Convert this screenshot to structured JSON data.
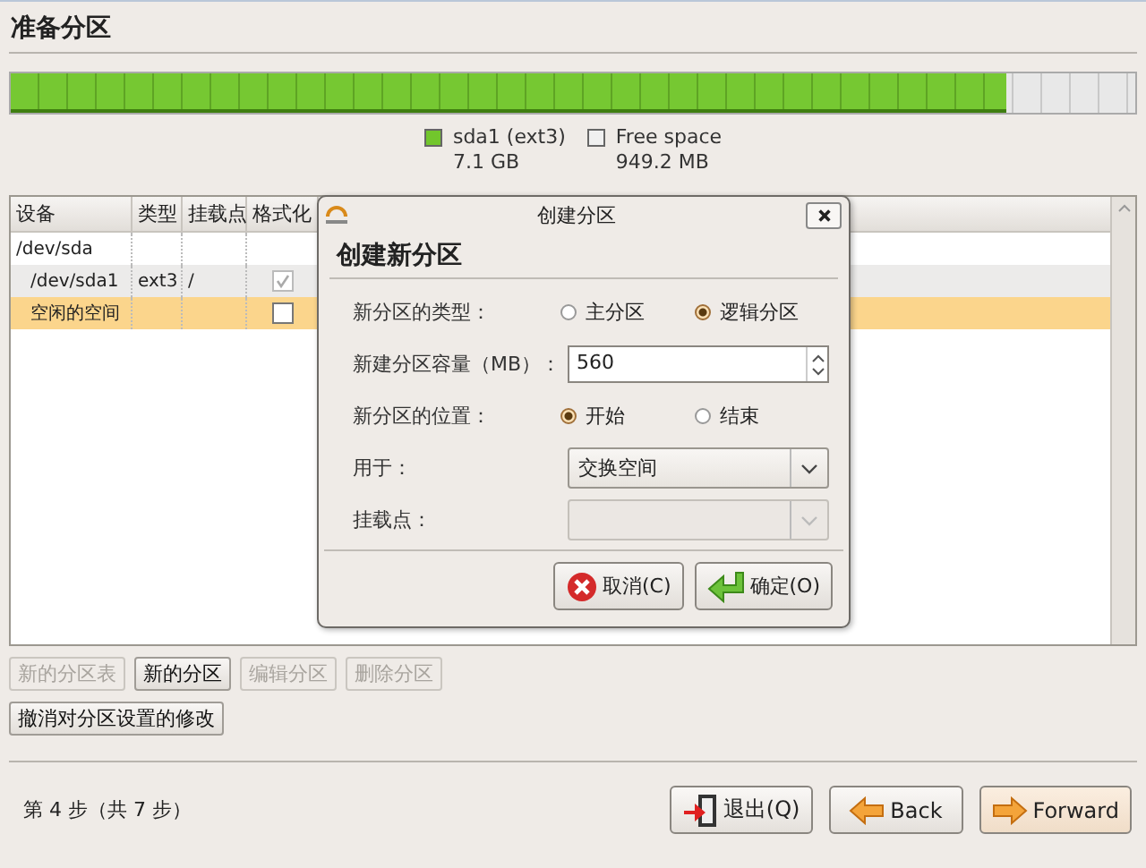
{
  "title": "准备分区",
  "disk_bar": {
    "level": 0.885
  },
  "legend": [
    {
      "name": "sda1 (ext3)",
      "size": "7.1 GB",
      "color": "#72c62c"
    },
    {
      "name": "Free space",
      "size": "949.2 MB",
      "color": "#f0f0f0"
    }
  ],
  "table": {
    "columns": [
      "设备",
      "类型",
      "挂载点",
      "格式化"
    ],
    "rows": [
      {
        "device": "/dev/sda",
        "selected": false,
        "children": [
          {
            "device": "/dev/sda1",
            "type": "ext3",
            "mount": "/",
            "format": {
              "checked": true,
              "disabled": true
            },
            "selected": false
          },
          {
            "device": "空闲的空间",
            "format": {
              "checked": false,
              "disabled": false
            },
            "selected": true
          }
        ]
      }
    ]
  },
  "dialog": {
    "title": "创建分区",
    "heading": "创建新分区",
    "fields": [
      {
        "kind": "radio",
        "label": "新分区的类型：",
        "options": [
          {
            "label": "主分区",
            "selected": false
          },
          {
            "label": "逻辑分区",
            "selected": true
          }
        ]
      },
      {
        "kind": "spin",
        "label": "新建分区容量（MB）：",
        "value": "560"
      },
      {
        "kind": "radio",
        "label": "新分区的位置：",
        "options": [
          {
            "label": "开始",
            "selected": true
          },
          {
            "label": "结束",
            "selected": false
          }
        ]
      },
      {
        "kind": "combo",
        "label": "用于：",
        "value": "交换空间",
        "disabled": false
      },
      {
        "kind": "combo",
        "label": "挂载点：",
        "disabled": true
      }
    ],
    "buttons": [
      {
        "kind": "cancel",
        "label": "取消(C)"
      },
      {
        "kind": "ok",
        "label": "确定(O)"
      }
    ]
  },
  "actions": [
    {
      "label": "新的分区表",
      "disabled": true
    },
    {
      "label": "新的分区",
      "disabled": false
    },
    {
      "label": "编辑分区",
      "disabled": true
    },
    {
      "label": "删除分区",
      "disabled": true
    }
  ],
  "revert": "撤消对分区设置的修改",
  "step": "第 4 步（共 7 步）",
  "nav": [
    {
      "kind": "quit",
      "label": "退出(Q)",
      "default": false
    },
    {
      "kind": "back",
      "label": "Back",
      "default": false
    },
    {
      "kind": "forward",
      "label": "Forward",
      "default": true
    }
  ]
}
